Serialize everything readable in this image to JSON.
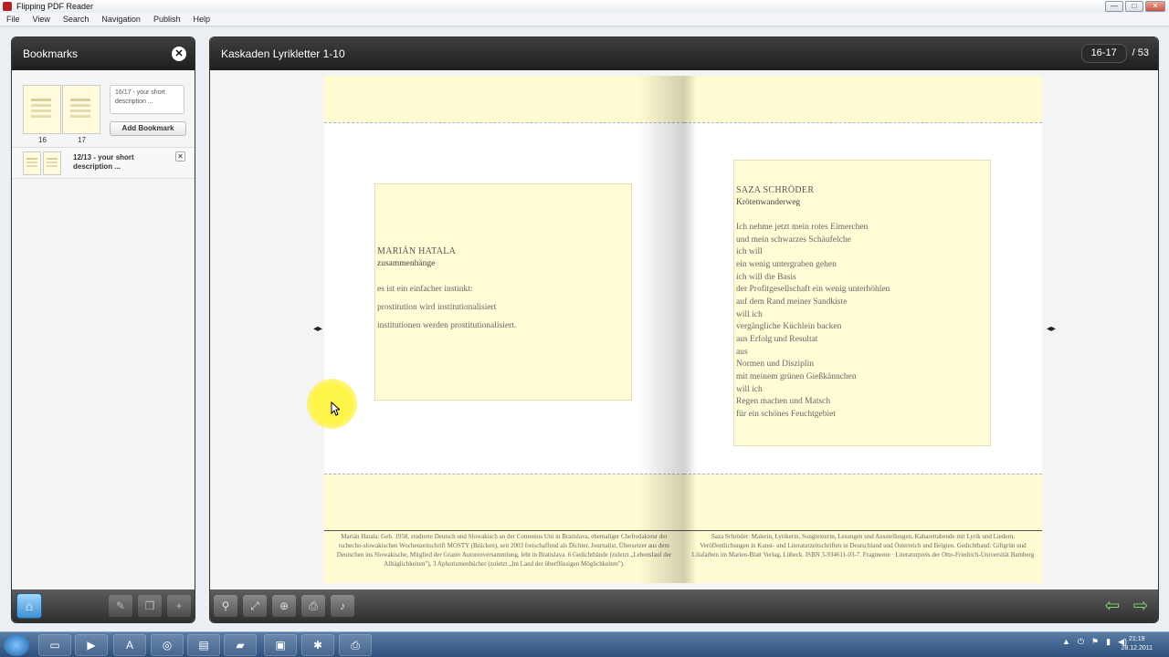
{
  "window": {
    "title": "Flipping PDF Reader",
    "controls": [
      "—",
      "□",
      "✕"
    ]
  },
  "menu": [
    "File",
    "View",
    "Search",
    "Navigation",
    "Publish",
    "Help"
  ],
  "bookmarks": {
    "title": "Bookmarks",
    "close": "✕",
    "new": {
      "thumb_left": "16",
      "thumb_right": "17",
      "description": "16/17 - your short description ...",
      "add_label": "Add Bookmark"
    },
    "items": [
      {
        "label": "12/13 - your short description ...",
        "remove": "✕"
      }
    ],
    "footer_icons": [
      "home-icon",
      "edit-bookmark-icon",
      "copy-bookmark-icon",
      "add-bookmark-icon"
    ]
  },
  "viewer": {
    "title": "Kaskaden Lyrikletter 1-10",
    "current_pages": "16-17",
    "total_pages": "/ 53",
    "toolbar_icons": [
      "search-icon",
      "fullscreen-icon",
      "zoom-icon",
      "print-icon",
      "sound-icon",
      "prev-icon",
      "next-icon"
    ]
  },
  "book": {
    "left": {
      "author": "MARIÁN HATALA",
      "title": "zusammenhänge",
      "lines": [
        "es ist ein einfacher instinkt:",
        "prostitution wird institutionalisiert",
        "institutionen werden prostitutionalisiert."
      ],
      "footer": "Marián Hatala: Geb. 1958, studierte Deutsch und Slowakisch an der Comenius Uni in Bratislava, ehemaliger Chefredakteur der tschecho-slowakischen Wochenzeitschrift MOSTY (Brücken), seit 2003 freischaffend als Dichter, Journalist, Übersetzer aus dem Deutschen ins Slowakische, Mitglied der Grazer Autorenversammlung, lebt in Bratislava. 6 Gedichtbände (zuletzt „Lebenslauf der Alltäglichkeiten\"), 3 Aphorismenbücher (zuletzt „Im Land der überflüssigen Möglichkeiten\")."
    },
    "right": {
      "author": "SAZA SCHRÖDER",
      "title": "Krötenwanderweg",
      "lines": [
        "Ich nehme jetzt mein rotes Eimerchen",
        "und mein schwarzes Schäufelche",
        "ich will",
        "ein wenig untergraben gehen",
        "ich will die Basis",
        "der Profitgesellschaft ein wenig unterhöhlen",
        "auf dem Rand meiner Sandkiste",
        "will ich",
        "vergängliche Küchlein backen",
        "aus Erfolg und Resultat",
        "aus",
        "Normen und Disziplin",
        "mit meinem grünen Gießkännchen",
        "will ich",
        "Regen machen und Matsch",
        "für ein schönes Feuchtgebiet"
      ],
      "footer": "Saza Schröder: Malerin, Lyrikerin, Songtexterin, Lesungen und Ausstellungen, Kabarettabende mit Lyrik und Liedern, Veröffentlichungen in Kunst- und Literaturzeitschriften in Deutschland und Österreich und Belgien. Gedichtband: Giftgrün und Lilafarben im Marien-Blatt Verlag, Lübeck. ISBN 3-934611-03-7. Fragmente · Literaturpreis der Otto-Friedrich-Universität Bamberg"
    }
  },
  "taskbar": {
    "apps": [
      "explorer-icon",
      "media-player-icon",
      "acrobat-icon",
      "chrome-icon",
      "winrar-icon",
      "flipping-pdf-icon",
      "remote-desktop-icon",
      "tool-icon",
      "printer-icon"
    ],
    "tray": [
      "▲",
      "⏻",
      "⚑",
      "▮",
      "◀)"
    ],
    "time": "21:19",
    "date": "28.12.2011"
  }
}
